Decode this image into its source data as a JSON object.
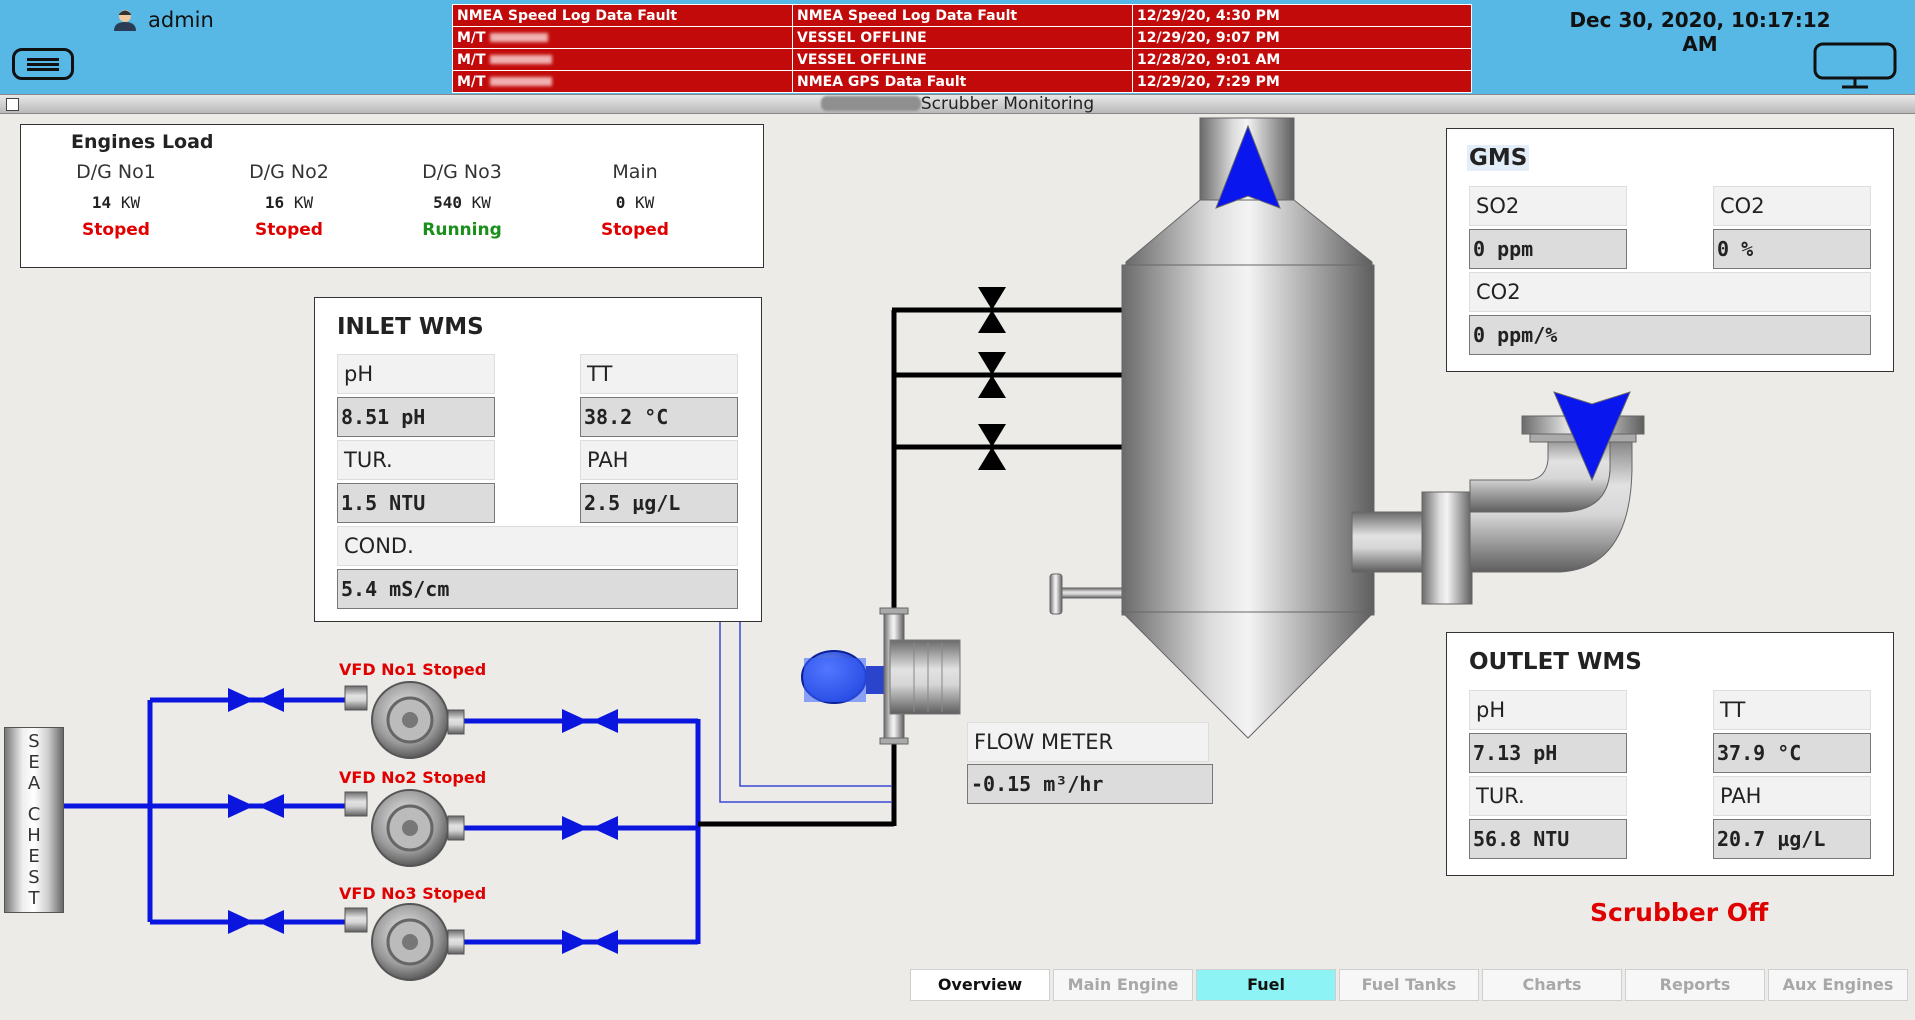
{
  "header": {
    "user": "admin",
    "clock": "Dec 30, 2020, 10:17:12 AM",
    "alarms": [
      {
        "source": "NMEA Speed Log Data Fault",
        "message": "NMEA Speed Log Data Fault",
        "time": "12/29/20, 4:30 PM"
      },
      {
        "source": "M/T",
        "message": "VESSEL OFFLINE",
        "time": "12/29/20, 9:07 PM"
      },
      {
        "source": "M/T",
        "message": "VESSEL OFFLINE",
        "time": "12/28/20, 9:01 AM"
      },
      {
        "source": "M/T",
        "message": "NMEA GPS Data Fault",
        "time": "12/29/20, 7:29 PM"
      }
    ]
  },
  "window_title": "Scrubber Monitoring",
  "engines": {
    "title": "Engines Load",
    "unit": "KW",
    "items": [
      {
        "name": "D/G No1",
        "value": "14",
        "status": "Stoped"
      },
      {
        "name": "D/G No2",
        "value": "16",
        "status": "Stoped"
      },
      {
        "name": "D/G No3",
        "value": "540",
        "status": "Running"
      },
      {
        "name": "Main",
        "value": "0",
        "status": "Stoped"
      }
    ]
  },
  "inlet": {
    "title": "INLET WMS",
    "ph_label": "pH",
    "ph_value": "8.51 pH",
    "tt_label": "TT",
    "tt_value": "38.2 °C",
    "tur_label": "TUR.",
    "tur_value": "1.5 NTU",
    "pah_label": "PAH",
    "pah_value": "2.5 µg/L",
    "cond_label": "COND.",
    "cond_value": "5.4 mS/cm"
  },
  "gms": {
    "title": "GMS",
    "so2_label": "SO2",
    "so2_value": "0 ppm",
    "co2_label": "CO2",
    "co2_value": "0 %",
    "co2b_label": "CO2",
    "co2b_value": "0 ppm/%"
  },
  "outlet": {
    "title": "OUTLET WMS",
    "ph_label": "pH",
    "ph_value": "7.13 pH",
    "tt_label": "TT",
    "tt_value": "37.9 °C",
    "tur_label": "TUR.",
    "tur_value": "56.8 NTU",
    "pah_label": "PAH",
    "pah_value": "20.7 µg/L"
  },
  "flow_meter": {
    "label": "FLOW METER",
    "value": "-0.15 m³/hr"
  },
  "pumps": [
    "VFD No1 Stoped",
    "VFD No2 Stoped",
    "VFD No3 Stoped"
  ],
  "sea_chest": [
    "S",
    "E",
    "A",
    "",
    "C",
    "H",
    "E",
    "S",
    "T"
  ],
  "status": "Scrubber Off",
  "tabs": [
    "Overview",
    "Main Engine",
    "Fuel",
    "Fuel Tanks",
    "Charts",
    "Reports",
    "Aux Engines"
  ],
  "colors": {
    "header": "#57b8e5",
    "alarm": "#c20a0a",
    "pipe_blue": "#0a16dd",
    "status_red": "#e00000",
    "running_green": "#1a8f1a",
    "active_tab": "#8ef3f4"
  }
}
